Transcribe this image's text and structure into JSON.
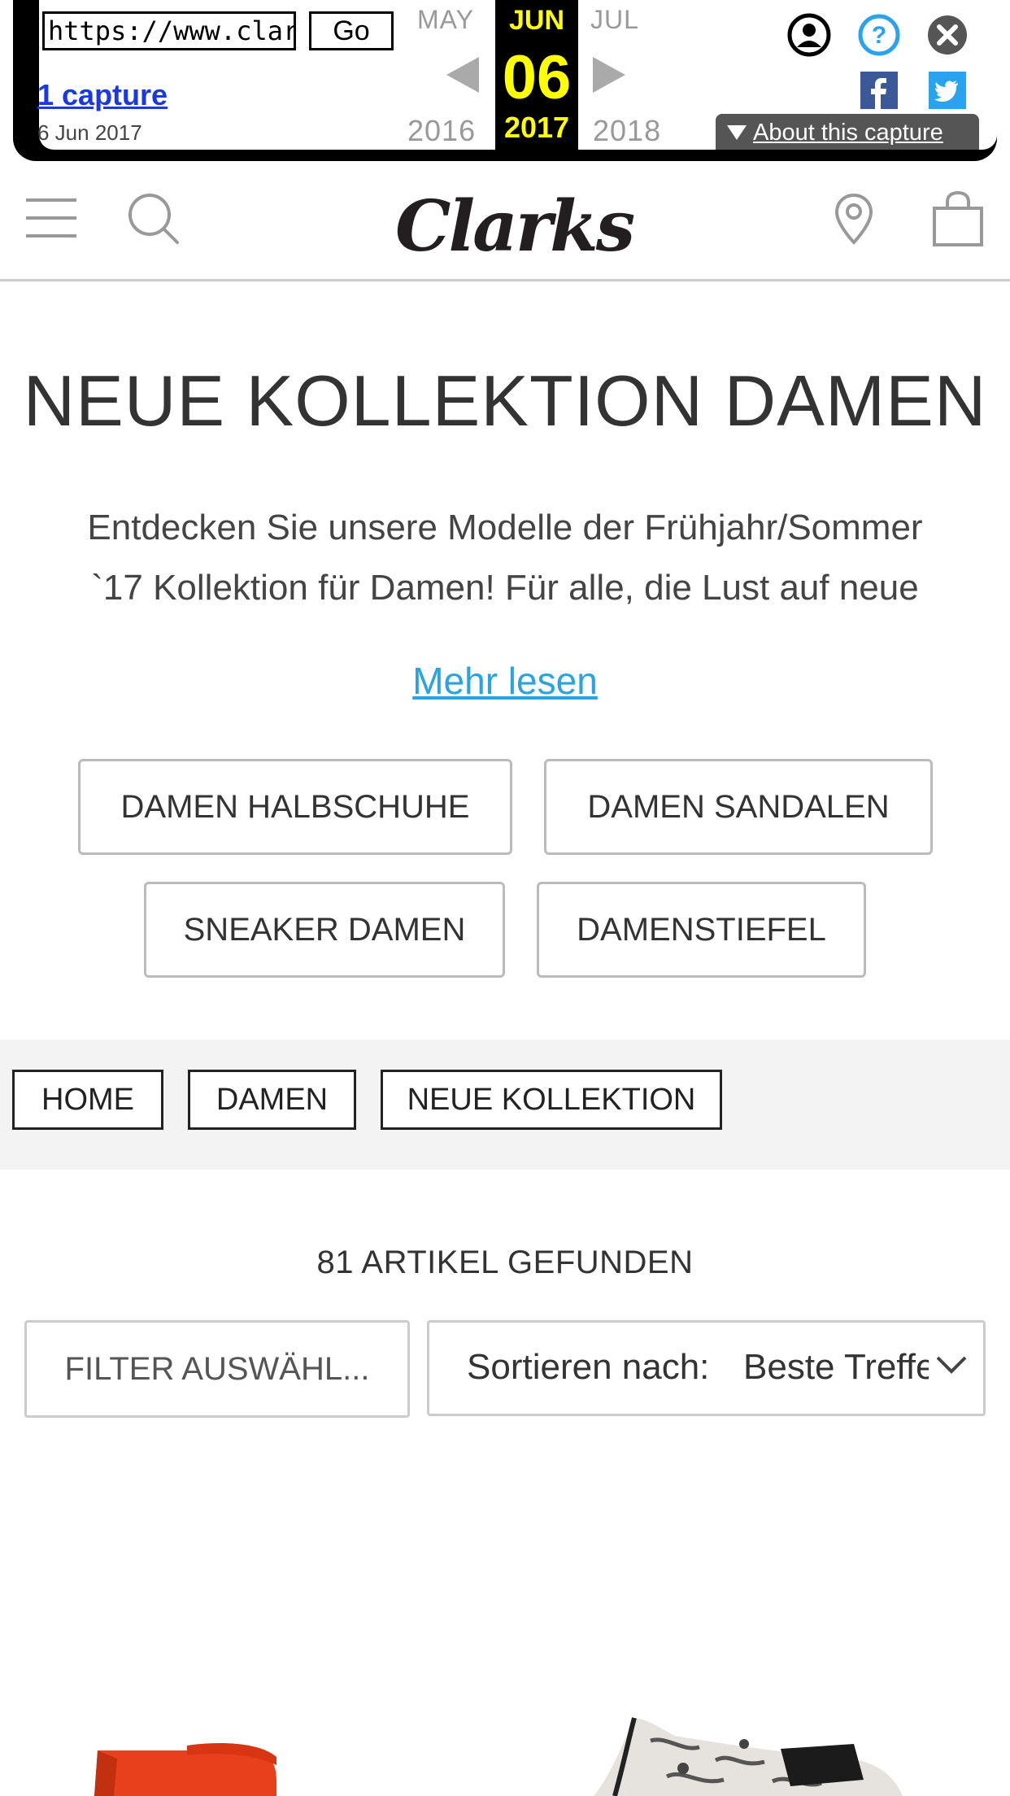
{
  "wayback": {
    "url_value": "https://www.clarks.de/c/damen-neue-kollektion",
    "go_label": "Go",
    "captures_label": "1 capture",
    "capture_date": "6 Jun 2017",
    "prev_month": "MAY",
    "current_month": "JUN",
    "next_month": "JUL",
    "current_day": "06",
    "prev_year": "2016",
    "current_year": "2017",
    "next_year": "2018",
    "about_label": "About this capture",
    "icons": [
      "user-icon",
      "help-icon",
      "close-icon",
      "facebook-icon",
      "twitter-icon"
    ],
    "colors": {
      "highlight": "#ffff00",
      "facebook": "#3b5998",
      "twitter": "#2aa3ef"
    }
  },
  "header": {
    "logo_text": "Clarks",
    "icons": [
      "menu-icon",
      "search-icon",
      "store-locator-icon",
      "shopping-bag-icon"
    ]
  },
  "main": {
    "title": "NEUE KOLLEKTION DAMEN",
    "intro_line1": "Entdecken Sie unsere Modelle der Frühjahr/Sommer",
    "intro_line2": "`17 Kollektion für Damen! Für alle, die Lust auf neue",
    "more_link": "Mehr lesen",
    "categories": [
      "DAMEN HALBSCHUHE",
      "DAMEN SANDALEN",
      "SNEAKER DAMEN",
      "DAMENSTIEFEL"
    ]
  },
  "breadcrumb": [
    "HOME",
    "DAMEN",
    "NEUE KOLLEKTION"
  ],
  "results": {
    "count_text": "81 ARTIKEL GEFUNDEN",
    "filter_label": "FILTER AUSWÄHL...",
    "sort_label": "Sortieren nach:",
    "sort_value": "Beste Treffer"
  },
  "colors": {
    "link": "#2aa3e0",
    "product_1": "#e8401c"
  }
}
